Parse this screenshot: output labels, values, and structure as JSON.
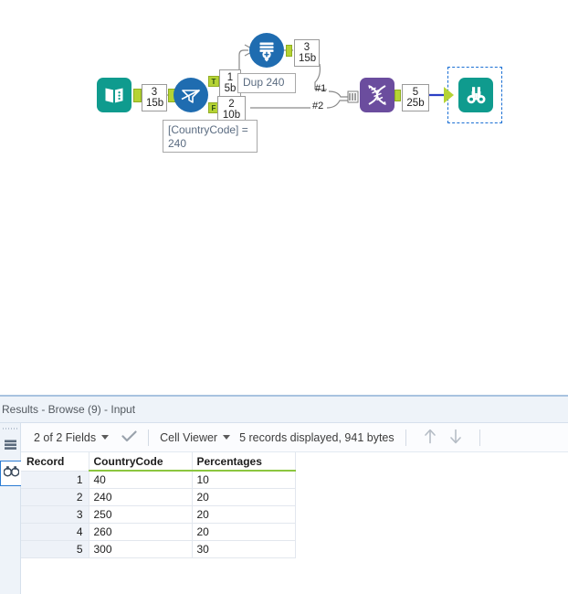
{
  "app": {
    "canvas_background": "#ffffff",
    "accent_blue": "#2b7cd3"
  },
  "workflow": {
    "tools": [
      {
        "id": "input-data",
        "name": "Input Data",
        "icon": "book-icon",
        "color": "#0f9b8e",
        "shape": "rounded-square"
      },
      {
        "id": "filter",
        "name": "Filter",
        "icon": "funnel-icon",
        "color": "#1f6cb0",
        "shape": "circle",
        "annotation": "[CountryCode] = 240",
        "true_label": "T",
        "false_label": "F"
      },
      {
        "id": "summarize",
        "name": "Summarize",
        "icon": "summarize-icon",
        "color": "#1f6cb0",
        "shape": "circle",
        "annotation": "Dup 240"
      },
      {
        "id": "union",
        "name": "Union",
        "icon": "union-icon",
        "color": "#6b4d9e",
        "shape": "rounded-square",
        "input1_label": "#1",
        "input2_label": "#2"
      },
      {
        "id": "browse",
        "name": "Browse",
        "icon": "binoculars-icon",
        "color": "#0f9b8e",
        "shape": "rounded-square",
        "selected": true
      }
    ],
    "connections": [
      {
        "id": "input-to-filter",
        "records": "3",
        "size": "15b"
      },
      {
        "id": "filter-true-to-summarize",
        "records": "1",
        "size": "5b"
      },
      {
        "id": "filter-false-to-union",
        "records": "2",
        "size": "10b"
      },
      {
        "id": "summarize-to-union",
        "records": "3",
        "size": "15b"
      },
      {
        "id": "union-to-browse",
        "records": "5",
        "size": "25b"
      }
    ]
  },
  "results": {
    "title": "Results - Browse (9) - Input",
    "toolbar": {
      "fields": "2 of 2 Fields",
      "viewer": "Cell Viewer",
      "status": "5 records displayed, 941 bytes",
      "check_icon": "checkmark-icon",
      "up_icon": "arrow-up-icon",
      "down_icon": "arrow-down-icon"
    },
    "rail": {
      "table_icon": "table-view-icon",
      "browse_icon": "binoculars-icon"
    },
    "table": {
      "columns": [
        "Record",
        "CountryCode",
        "Percentages"
      ],
      "rows": [
        {
          "record": "1",
          "country_code": "40",
          "percentages": "10"
        },
        {
          "record": "2",
          "country_code": "240",
          "percentages": "20"
        },
        {
          "record": "3",
          "country_code": "250",
          "percentages": "20"
        },
        {
          "record": "4",
          "country_code": "260",
          "percentages": "20"
        },
        {
          "record": "5",
          "country_code": "300",
          "percentages": "30"
        }
      ]
    }
  }
}
